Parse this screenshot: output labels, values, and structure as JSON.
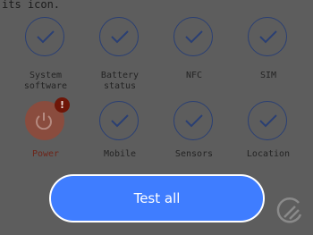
{
  "header": {
    "text": "its icon."
  },
  "tests": [
    {
      "label": "System\nsoftware",
      "icon": "check-icon",
      "state": "pending"
    },
    {
      "label": "Battery\nstatus",
      "icon": "check-icon",
      "state": "pending"
    },
    {
      "label": "NFC",
      "icon": "check-icon",
      "state": "pending"
    },
    {
      "label": "SIM",
      "icon": "check-icon",
      "state": "pending"
    },
    {
      "label": "Power",
      "icon": "power-icon",
      "state": "failed",
      "alert": "!"
    },
    {
      "label": "Mobile",
      "icon": "check-icon",
      "state": "pending"
    },
    {
      "label": "Sensors",
      "icon": "check-icon",
      "state": "pending"
    },
    {
      "label": "Location",
      "icon": "check-icon",
      "state": "pending"
    }
  ],
  "footer": {
    "test_all_label": "Test all"
  },
  "colors": {
    "accent": "#3f7dff",
    "ring": "#2a3f73",
    "alert": "#6e1608",
    "overlay": "#5d5d5d"
  }
}
